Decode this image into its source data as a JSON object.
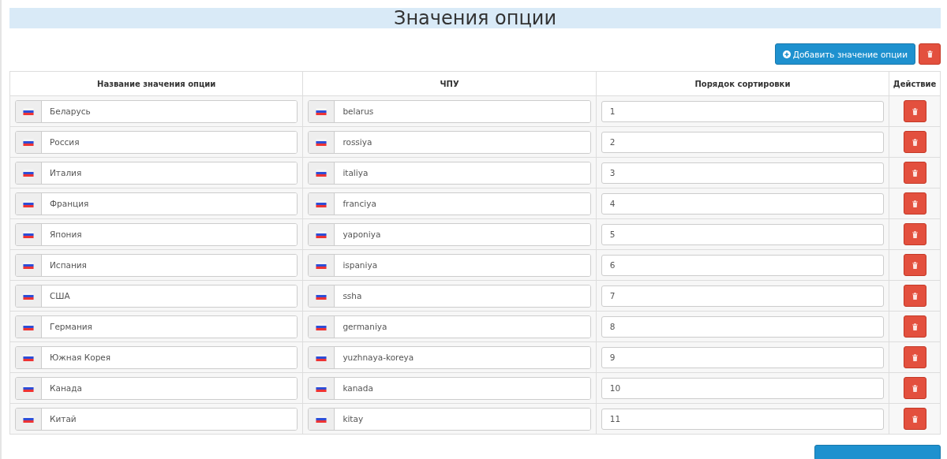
{
  "title": "Значения опции",
  "toolbar": {
    "add_button": "Добавить значение опции"
  },
  "table": {
    "columns": [
      "Название значения опции",
      "ЧПУ",
      "Порядок сортировки",
      "Действие"
    ],
    "rows": [
      {
        "name": "Беларусь",
        "slug": "belarus",
        "sort_order": "1"
      },
      {
        "name": "Россия",
        "slug": "rossiya",
        "sort_order": "2"
      },
      {
        "name": "Италия",
        "slug": "italiya",
        "sort_order": "3"
      },
      {
        "name": "Франция",
        "slug": "franciya",
        "sort_order": "4"
      },
      {
        "name": "Япония",
        "slug": "yaponiya",
        "sort_order": "5"
      },
      {
        "name": "Испания",
        "slug": "ispaniya",
        "sort_order": "6"
      },
      {
        "name": "США",
        "slug": "ssha",
        "sort_order": "7"
      },
      {
        "name": "Германия",
        "slug": "germaniya",
        "sort_order": "8"
      },
      {
        "name": "Южная Корея",
        "slug": "yuzhnaya-koreya",
        "sort_order": "9"
      },
      {
        "name": "Канада",
        "slug": "kanada",
        "sort_order": "10"
      },
      {
        "name": "Китай",
        "slug": "kitay",
        "sort_order": "11"
      }
    ]
  }
}
